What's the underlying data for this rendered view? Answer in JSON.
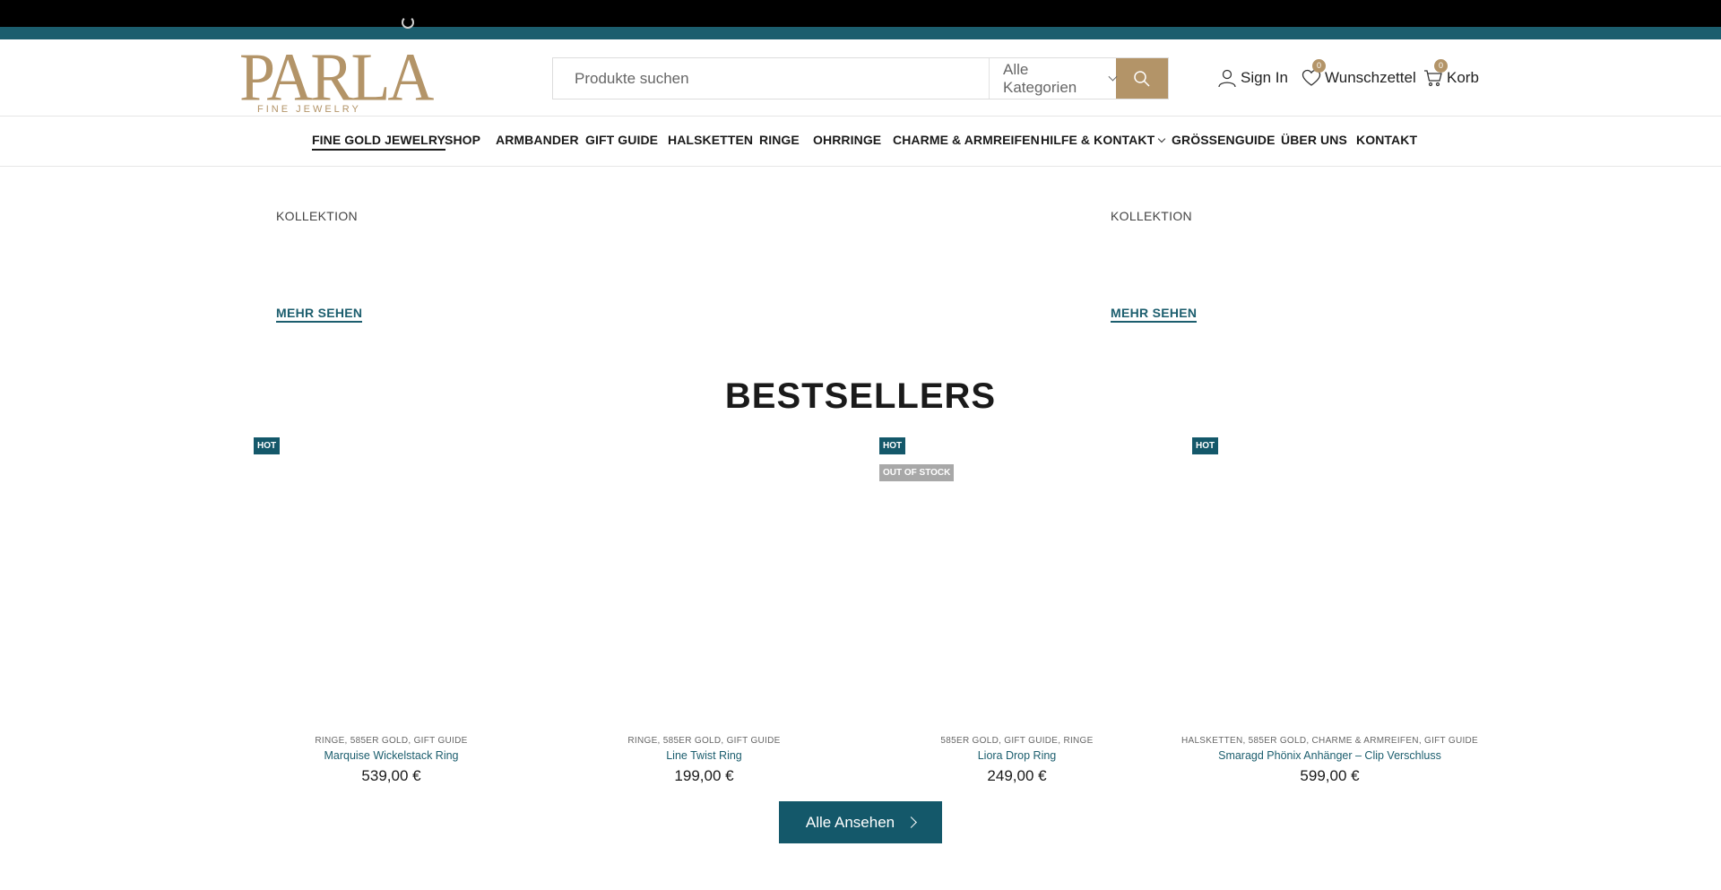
{
  "brand": {
    "logo_text": "PARLA",
    "logo_sub": "FINE JEWELRY",
    "accent": "#b39468",
    "primary": "#14586a"
  },
  "search": {
    "placeholder": "Produkte suchen",
    "category": "Alle Kategorien",
    "button_icon": "search-icon"
  },
  "header_actions": {
    "sign_in": "Sign In",
    "wishlist": "Wunschzettel",
    "wishlist_count": "0",
    "cart": "Korb",
    "cart_count": "0"
  },
  "nav": {
    "items": [
      "FINE GOLD JEWELRY",
      "SHOP",
      "ARMBANDER",
      "GIFT GUIDE",
      "HALSKETTEN",
      "RINGE",
      "OHRRINGE",
      "CHARME & ARMREIFEN",
      "HILFE & KONTAKT",
      "GRÖSSENGUIDE",
      "ÜBER UNS",
      "KONTAKT"
    ]
  },
  "collections": [
    {
      "label": "KOLLEKTION",
      "link": "MEHR SEHEN"
    },
    {
      "label": "KOLLEKTION",
      "link": "MEHR SEHEN"
    }
  ],
  "bestsellers": {
    "title": "BESTSELLERS",
    "products": [
      {
        "tags": [
          "HOT"
        ],
        "cats": "RINGE,  585ER GOLD,  GIFT GUIDE",
        "name": "Marquise Wickelstack Ring",
        "price": "539,00 €"
      },
      {
        "tags": [],
        "cats": "RINGE,  585ER GOLD,  GIFT GUIDE",
        "name": "Line Twist Ring",
        "price": "199,00 €"
      },
      {
        "tags": [
          "HOT",
          "OUT OF STOCK"
        ],
        "cats": "585ER GOLD,  GIFT GUIDE,  RINGE",
        "name": "Liora Drop Ring",
        "price": "249,00 €"
      },
      {
        "tags": [
          "HOT"
        ],
        "cats": "HALSKETTEN,  585ER GOLD,  CHARME & ARMREIFEN,  GIFT GUIDE",
        "name": "Smaragd Phönix Anhänger – Clip Verschluss",
        "price": "599,00 €"
      }
    ],
    "view_all": "Alle Ansehen"
  }
}
